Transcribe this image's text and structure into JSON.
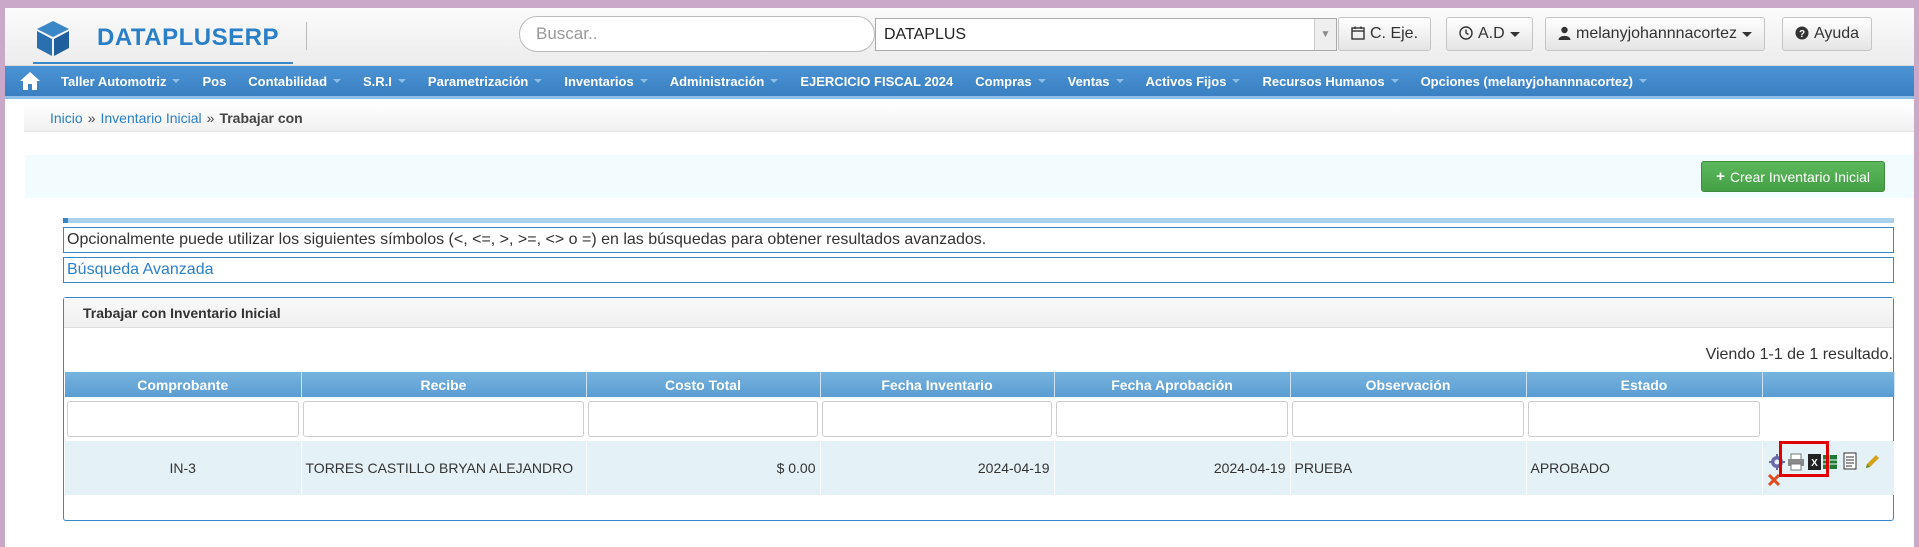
{
  "header": {
    "brand": "DATAPLUSERP",
    "search_placeholder": "Buscar..",
    "company": "DATAPLUS",
    "c_eje": "C. Eje.",
    "ad": "A.D",
    "user": "melanyjohannnacortez",
    "help": "Ayuda"
  },
  "nav": [
    {
      "label": "Taller Automotriz",
      "dropdown": true
    },
    {
      "label": "Pos",
      "dropdown": false
    },
    {
      "label": "Contabilidad",
      "dropdown": true
    },
    {
      "label": "S.R.I",
      "dropdown": true
    },
    {
      "label": "Parametrización",
      "dropdown": true
    },
    {
      "label": "Inventarios",
      "dropdown": true
    },
    {
      "label": "Administración",
      "dropdown": true
    },
    {
      "label": "EJERCICIO FISCAL 2024",
      "dropdown": false
    },
    {
      "label": "Compras",
      "dropdown": true
    },
    {
      "label": "Ventas",
      "dropdown": true
    },
    {
      "label": "Activos Fijos",
      "dropdown": true
    },
    {
      "label": "Recursos Humanos",
      "dropdown": true
    },
    {
      "label": "Opciones (melanyjohannnacortez)",
      "dropdown": true
    }
  ],
  "breadcrumb": {
    "home": "Inicio",
    "sep1": "»",
    "section": "Inventario Inicial",
    "sep2": "»",
    "current": "Trabajar con"
  },
  "actions": {
    "create_label": "Crear Inventario Inicial"
  },
  "info_text": "Opcionalmente puede utilizar los siguientes símbolos (<, <=, >, >=, <> o =) en las búsquedas para obtener resultados avanzados.",
  "advanced_search": "Búsqueda Avanzada",
  "panel": {
    "title": "Trabajar con Inventario Inicial",
    "summary": "Viendo 1-1 de 1 resultado."
  },
  "table": {
    "columns": [
      "Comprobante",
      "Recibe",
      "Costo Total",
      "Fecha Inventario",
      "Fecha Aprobación",
      "Observación",
      "Estado"
    ],
    "rows": [
      {
        "comprobante": "IN-3",
        "recibe": "TORRES CASTILLO BRYAN ALEJANDRO",
        "costo_total": "$ 0.00",
        "fecha_inventario": "2024-04-19",
        "fecha_aprobacion": "2024-04-19",
        "observacion": "PRUEBA",
        "estado": "APROBADO"
      }
    ]
  },
  "colors": {
    "brand_blue": "#2a7fc9",
    "nav_blue": "#3a80c2",
    "create_green": "#5cb85c",
    "highlight_red": "#e00000"
  }
}
